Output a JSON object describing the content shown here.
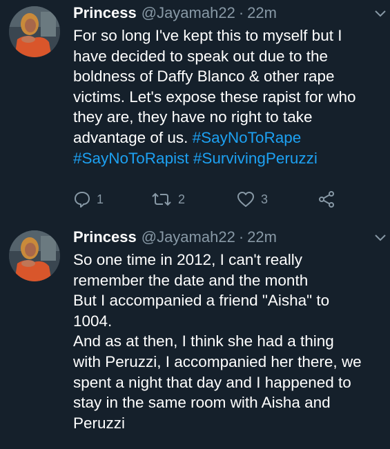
{
  "tweets": [
    {
      "name": "Princess",
      "handle": "@Jayamah22",
      "separator": "·",
      "time": "22m",
      "lines": [
        {
          "text": "For so long I've kept this to myself but I",
          "tags": ""
        },
        {
          "text": "have decided to speak out due to the",
          "tags": ""
        },
        {
          "text": "boldness of Daffy Blanco & other rape",
          "tags": ""
        },
        {
          "text": "victims. Let's expose these rapist for who",
          "tags": ""
        },
        {
          "text": "they are, they have no right to take",
          "tags": ""
        },
        {
          "text": "advantage of us. ",
          "tags": "#SayNoToRape"
        },
        {
          "text": "",
          "tags": "#SayNoToRapist #SurvivingPeruzzi"
        }
      ],
      "actions": {
        "reply_count": "1",
        "retweet_count": "2",
        "like_count": "3"
      }
    },
    {
      "name": "Princess",
      "handle": "@Jayamah22",
      "separator": "·",
      "time": "22m",
      "lines": [
        {
          "text": "So one time in 2012, I can't really",
          "tags": ""
        },
        {
          "text": "remember the date and the month",
          "tags": ""
        },
        {
          "text": "But I accompanied a friend \"Aisha\" to",
          "tags": ""
        },
        {
          "text": "1004.",
          "tags": ""
        },
        {
          "text": "And as at then, I think she had a thing",
          "tags": ""
        },
        {
          "text": "with Peruzzi, I accompanied her there, we",
          "tags": ""
        },
        {
          "text": "spent a night that day and I happened to",
          "tags": ""
        },
        {
          "text": "stay in the same room with Aisha and",
          "tags": ""
        },
        {
          "text": "Peruzzi",
          "tags": ""
        }
      ]
    }
  ],
  "icons": {
    "reply": "reply-icon",
    "retweet": "retweet-icon",
    "like": "heart-icon",
    "share": "share-icon",
    "menu": "chevron-down-icon"
  },
  "colors": {
    "background": "#15202b",
    "secondary_text": "#8899a6",
    "link": "#1da1f2",
    "primary_text": "#ffffff"
  }
}
